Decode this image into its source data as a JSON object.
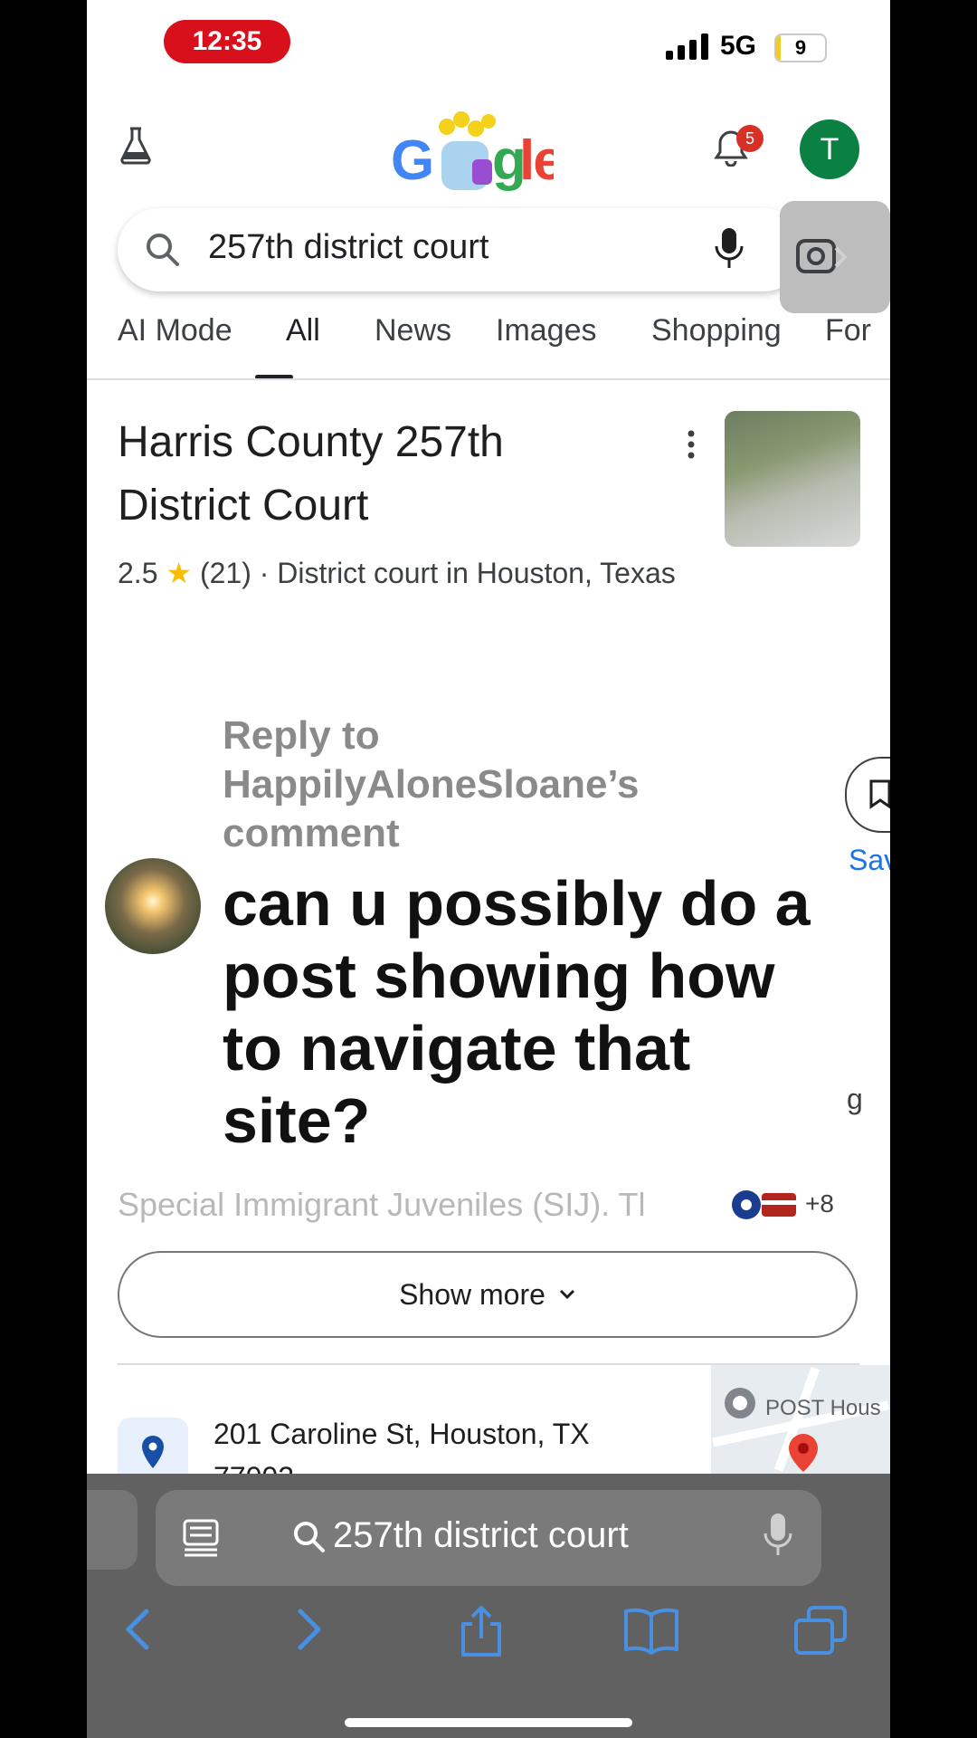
{
  "status_bar": {
    "time": "12:35",
    "network": "5G",
    "battery": "9",
    "battery_level": 0.09
  },
  "google": {
    "logo_text": "Google",
    "notification_count": "5",
    "avatar_letter": "T",
    "search_query": "257th district court",
    "tabs": [
      "AI Mode",
      "All",
      "News",
      "Images",
      "Shopping",
      "For"
    ],
    "active_tab": "All"
  },
  "result": {
    "title": "Harris County 257th District Court",
    "rating": "2.5",
    "reviews": "(21)",
    "category": "· District court in Houston, Texas",
    "save_label": "Sav",
    "glimpse_text": "g",
    "snippet": "Special Immigrant Juveniles (SIJ). Tl",
    "sources_more": "+8",
    "show_more": "Show more",
    "address": "201 Caroline St, Houston, TX 77002",
    "map_label": "POST Hous"
  },
  "overlay": {
    "reply_header": "Reply to HappilyAloneSloane’s comment",
    "message": "can u possibly do a post showing how to navigate that site?"
  },
  "browser": {
    "url_text": "257th district court"
  },
  "icons": [
    "flask-icon",
    "bell-icon",
    "search-icon",
    "mic-icon",
    "lens-icon",
    "kebab-icon",
    "bookmark-icon",
    "pin-icon",
    "reader-icon",
    "back-icon",
    "forward-icon",
    "share-icon",
    "bookmarks-icon",
    "tabs-icon"
  ]
}
